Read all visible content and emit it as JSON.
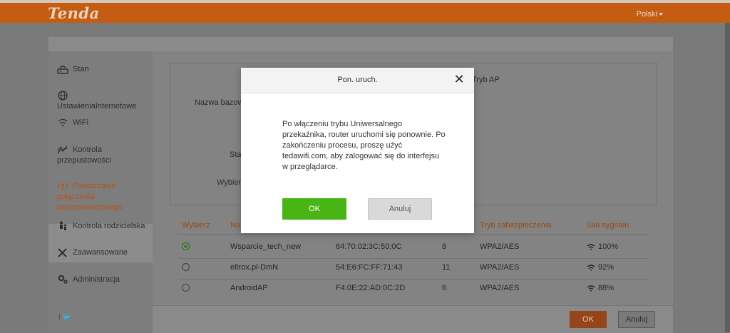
{
  "header": {
    "logo": "Tenda",
    "language": "Polski"
  },
  "sidebar": {
    "items": [
      {
        "label": "Stan",
        "icon": "router-icon"
      },
      {
        "label": "UstawieniaInternetowe",
        "icon": "globe-icon"
      },
      {
        "label": "WiFi",
        "icon": "wifi-icon"
      },
      {
        "label": "Kontrola przepustowości",
        "icon": "bandwidth-icon"
      },
      {
        "label": "Powtarzanie połączenia bezprzewodowego",
        "icon": "repeater-icon"
      },
      {
        "label": "Kontrola rodzicielska",
        "icon": "parental-icon"
      },
      {
        "label": "Zaawansowane",
        "icon": "tools-icon"
      },
      {
        "label": "Administracja",
        "icon": "gear-icon"
      }
    ],
    "social": "f 🐦"
  },
  "panel": {
    "label_mode": "Tryb AP",
    "label_ssid": "Nazwa bazow",
    "label_status": "Sta",
    "label_select": "Wybier"
  },
  "table": {
    "headers": {
      "select": "Wybierz",
      "name": "Na",
      "security": "Tryb zabezpieczenia",
      "signal": "Siła sygnału"
    },
    "rows": [
      {
        "name": "Wsparcie_tech_new",
        "mac": "64:70:02:3C:50:0C",
        "channel": "8",
        "security": "WPA2/AES",
        "signal": "100%",
        "selected": true
      },
      {
        "name": "eltrox.pl-DmN",
        "mac": "54:E6:FC:FF:71:43",
        "channel": "11",
        "security": "WPA2/AES",
        "signal": "92%",
        "selected": false
      },
      {
        "name": "AndroidAP",
        "mac": "F4:0E:22:AD:0C:2D",
        "channel": "6",
        "security": "WPA2/AES",
        "signal": "88%",
        "selected": false
      }
    ]
  },
  "footer": {
    "ok": "OK",
    "cancel": "Anuluj"
  },
  "modal": {
    "title": "Pon. uruch.",
    "close": "✕",
    "message": "Po włączeniu trybu Uniwersalnego przekaźnika, router uruchomi się ponownie. Po zakończeniu procesu, proszę użyć tedawifi.com, aby zalogować się do interfejsu w przeglądarce.",
    "ok": "OK",
    "cancel": "Anuluj"
  },
  "colors": {
    "brand": "#c45d12",
    "accent_active": "#b65417",
    "modal_ok": "#48b515"
  }
}
